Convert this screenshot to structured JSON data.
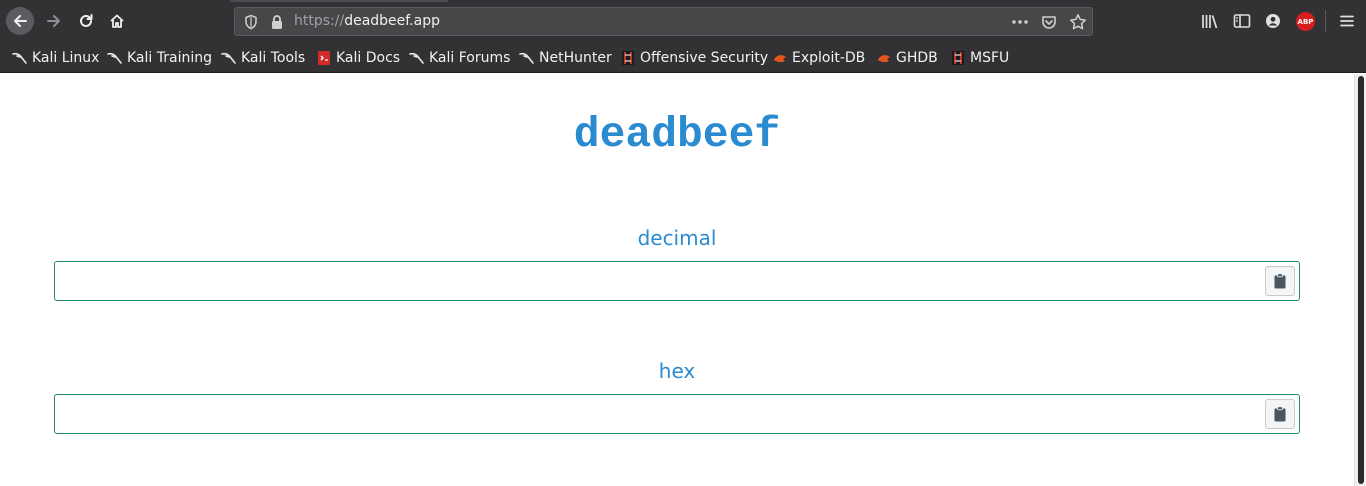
{
  "browser": {
    "url_protocol": "https://",
    "url_host": "deadbeef.app",
    "abp_label": "ABP"
  },
  "bookmarks": [
    {
      "label": "Kali Linux",
      "icon": "kali-dragon-icon"
    },
    {
      "label": "Kali Training",
      "icon": "kali-dragon-icon"
    },
    {
      "label": "Kali Tools",
      "icon": "kali-dragon-icon"
    },
    {
      "label": "Kali Docs",
      "icon": "kali-docs-icon"
    },
    {
      "label": "Kali Forums",
      "icon": "kali-dragon-icon"
    },
    {
      "label": "NetHunter",
      "icon": "kali-dragon-icon"
    },
    {
      "label": "Offensive Security",
      "icon": "offsec-icon"
    },
    {
      "label": "Exploit-DB",
      "icon": "exploitdb-icon"
    },
    {
      "label": "GHDB",
      "icon": "exploitdb-icon"
    },
    {
      "label": "MSFU",
      "icon": "offsec-icon"
    }
  ],
  "page": {
    "title": "deadbeef",
    "decimal_label": "decimal",
    "decimal_value": "",
    "hex_label": "hex",
    "hex_value": ""
  },
  "colors": {
    "accent": "#2a8bd0",
    "field_border": "#1f8a70"
  }
}
